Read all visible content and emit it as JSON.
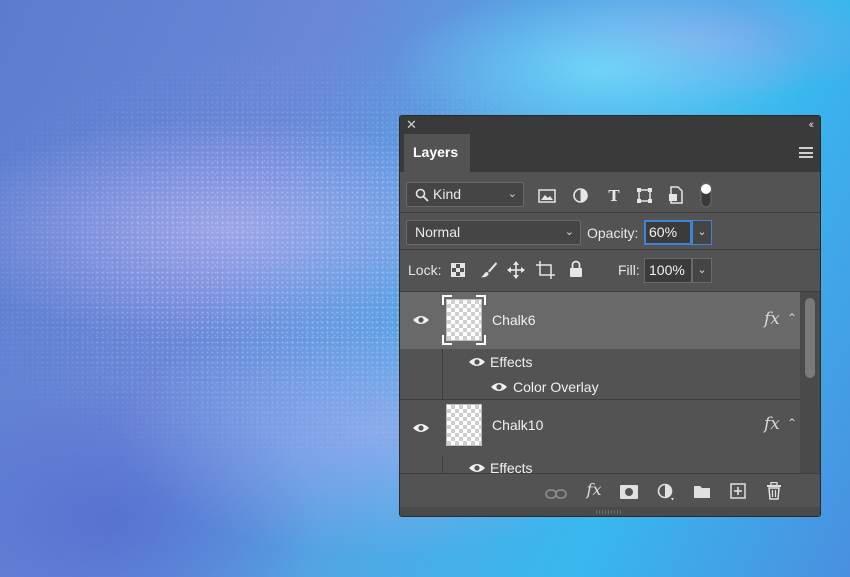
{
  "panel": {
    "close_glyph": "✕",
    "collapse_glyph": "‹‹",
    "tab_label": "Layers",
    "menu_icon": "hamburger-menu-icon"
  },
  "filter": {
    "kind_label": "Kind",
    "icons": [
      "pixel-layer-filter-icon",
      "adjustment-layer-filter-icon",
      "type-layer-filter-icon",
      "shape-layer-filter-icon",
      "smart-object-filter-icon",
      "filter-toggle-icon"
    ]
  },
  "blend": {
    "mode": "Normal",
    "opacity_label": "Opacity:",
    "opacity_value": "60%"
  },
  "lock": {
    "label": "Lock:",
    "icons": [
      "lock-transparent-pixels-icon",
      "lock-image-pixels-icon",
      "lock-position-icon",
      "lock-artboards-icon",
      "lock-all-icon"
    ],
    "fill_label": "Fill:",
    "fill_value": "100%"
  },
  "layers": [
    {
      "name": "Chalk6",
      "selected": true,
      "fx": "fx",
      "effects_label": "Effects",
      "effects": [
        "Color Overlay"
      ]
    },
    {
      "name": "Chalk10",
      "selected": false,
      "fx": "fx",
      "effects_label": "Effects",
      "effects": []
    }
  ],
  "bottom_bar": {
    "icons": [
      "link-layers-icon",
      "add-layer-style-icon",
      "add-mask-icon",
      "new-adjustment-layer-icon",
      "new-group-icon",
      "new-layer-icon",
      "delete-layer-icon"
    ],
    "fx_label": "fx"
  },
  "colors": {
    "panel_bg": "#535353",
    "selected_row": "#696969",
    "focus_accent": "#3f83d9"
  }
}
